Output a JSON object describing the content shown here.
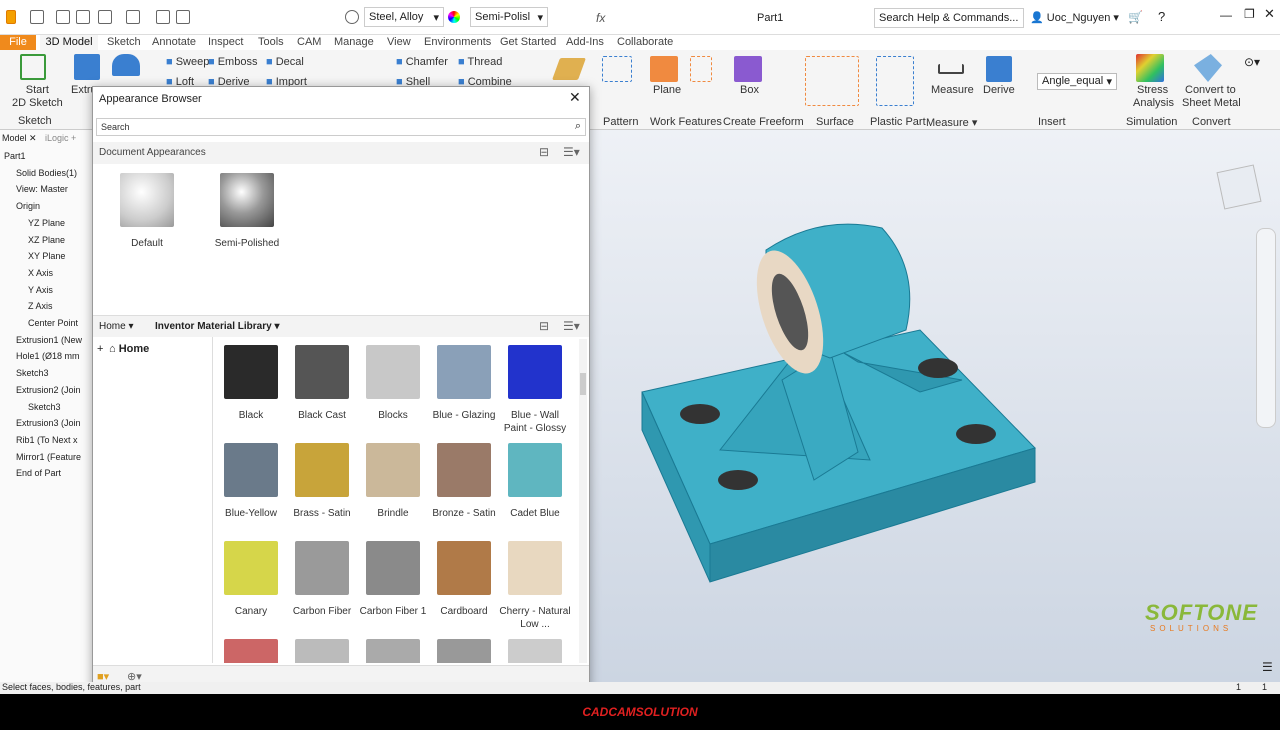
{
  "qat": {
    "material": "Steel, Alloy",
    "appearance": "Semi-Polisl",
    "doc_title": "Part1",
    "search": "Search Help & Commands...",
    "user": "Uoc_Nguyen"
  },
  "menu_tabs": [
    "File",
    "3D Model",
    "Sketch",
    "Annotate",
    "Inspect",
    "Tools",
    "CAM",
    "Manage",
    "View",
    "Environments",
    "Get Started",
    "Add-Ins",
    "Collaborate"
  ],
  "ribbon": {
    "start_sketch": "Start\n2D Sketch",
    "sketch": "Sketch",
    "extrude": "Extru",
    "sweep": "Sweep",
    "emboss": "Emboss",
    "decal": "Decal",
    "loft": "Loft",
    "derive_small": "Derive",
    "import": "Import",
    "chamfer": "Chamfer",
    "thread": "Thread",
    "shell": "Shell",
    "combine": "Combine",
    "plane": "Plane",
    "box": "Box",
    "measure": "Measure",
    "derive": "Derive",
    "param_value": "Angle_equal",
    "stress1": "Stress",
    "stress2": "Analysis",
    "convert1": "Convert to",
    "convert2": "Sheet Metal",
    "pattern": "Pattern",
    "work_features": "Work Features",
    "create_freeform": "Create Freeform",
    "surface": "Surface",
    "plastic_part": "Plastic Part",
    "measure_group": "Measure",
    "insert": "Insert",
    "simulation": "Simulation",
    "convert": "Convert"
  },
  "browser_tabs": {
    "model": "Model",
    "ilogic": "iLogic"
  },
  "tree": [
    {
      "label": "Part1",
      "indent": 0
    },
    {
      "label": "Solid Bodies(1)",
      "indent": 1
    },
    {
      "label": "View: Master",
      "indent": 1
    },
    {
      "label": "Origin",
      "indent": 1
    },
    {
      "label": "YZ Plane",
      "indent": 2
    },
    {
      "label": "XZ Plane",
      "indent": 2
    },
    {
      "label": "XY Plane",
      "indent": 2
    },
    {
      "label": "X Axis",
      "indent": 2
    },
    {
      "label": "Y Axis",
      "indent": 2
    },
    {
      "label": "Z Axis",
      "indent": 2
    },
    {
      "label": "Center Point",
      "indent": 2
    },
    {
      "label": "Extrusion1 (New",
      "indent": 1
    },
    {
      "label": "Hole1 (Ø18 mm",
      "indent": 1
    },
    {
      "label": "Sketch3",
      "indent": 1
    },
    {
      "label": "Extrusion2 (Join",
      "indent": 1
    },
    {
      "label": "Sketch3",
      "indent": 2
    },
    {
      "label": "Extrusion3 (Join",
      "indent": 1
    },
    {
      "label": "Rib1 (To Next x",
      "indent": 1
    },
    {
      "label": "Mirror1 (Feature",
      "indent": 1
    },
    {
      "label": "End of Part",
      "indent": 1
    }
  ],
  "dialog": {
    "title": "Appearance Browser",
    "search_placeholder": "Search",
    "doc_heading": "Document Appearances",
    "doc_items": [
      {
        "label": "Default"
      },
      {
        "label": "Semi-Polished"
      }
    ],
    "home": "Home",
    "library": "Inventor Material Library",
    "tree_home": "Home",
    "materials": [
      {
        "label": "Black",
        "color": "#2a2a2a"
      },
      {
        "label": "Black Cast",
        "color": "#555"
      },
      {
        "label": "Blocks",
        "color": "#c8c8c8"
      },
      {
        "label": "Blue - Glazing",
        "color": "#8aa0b8"
      },
      {
        "label": "Blue - Wall Paint - Glossy",
        "color": "#2233cc"
      },
      {
        "label": "Blue-Yellow",
        "color": "#6a7a8a"
      },
      {
        "label": "Brass - Satin",
        "color": "#c8a43a"
      },
      {
        "label": "Brindle",
        "color": "#cbb89a"
      },
      {
        "label": "Bronze - Satin",
        "color": "#9a7a68"
      },
      {
        "label": "Cadet Blue",
        "color": "#5fb6c0"
      },
      {
        "label": "Canary",
        "color": "#d6d64a"
      },
      {
        "label": "Carbon Fiber",
        "color": "#9a9a9a"
      },
      {
        "label": "Carbon Fiber 1",
        "color": "#8a8a8a"
      },
      {
        "label": "Cardboard",
        "color": "#b07a48"
      },
      {
        "label": "Cherry - Natural Low ...",
        "color": "#e8d8c0"
      },
      {
        "label": "",
        "color": "#cc6666"
      },
      {
        "label": "",
        "color": "#bbbbbb"
      },
      {
        "label": "",
        "color": "#aaaaaa"
      },
      {
        "label": "",
        "color": "#999999"
      },
      {
        "label": "",
        "color": "#cccccc"
      }
    ]
  },
  "status": {
    "text": "Select faces, bodies, features, part",
    "n1": "1",
    "n2": "1"
  },
  "watermark": {
    "brand": "SOFTONE",
    "sub": "SOLUTIONS"
  },
  "footer": "CADCAMSOLUTION"
}
